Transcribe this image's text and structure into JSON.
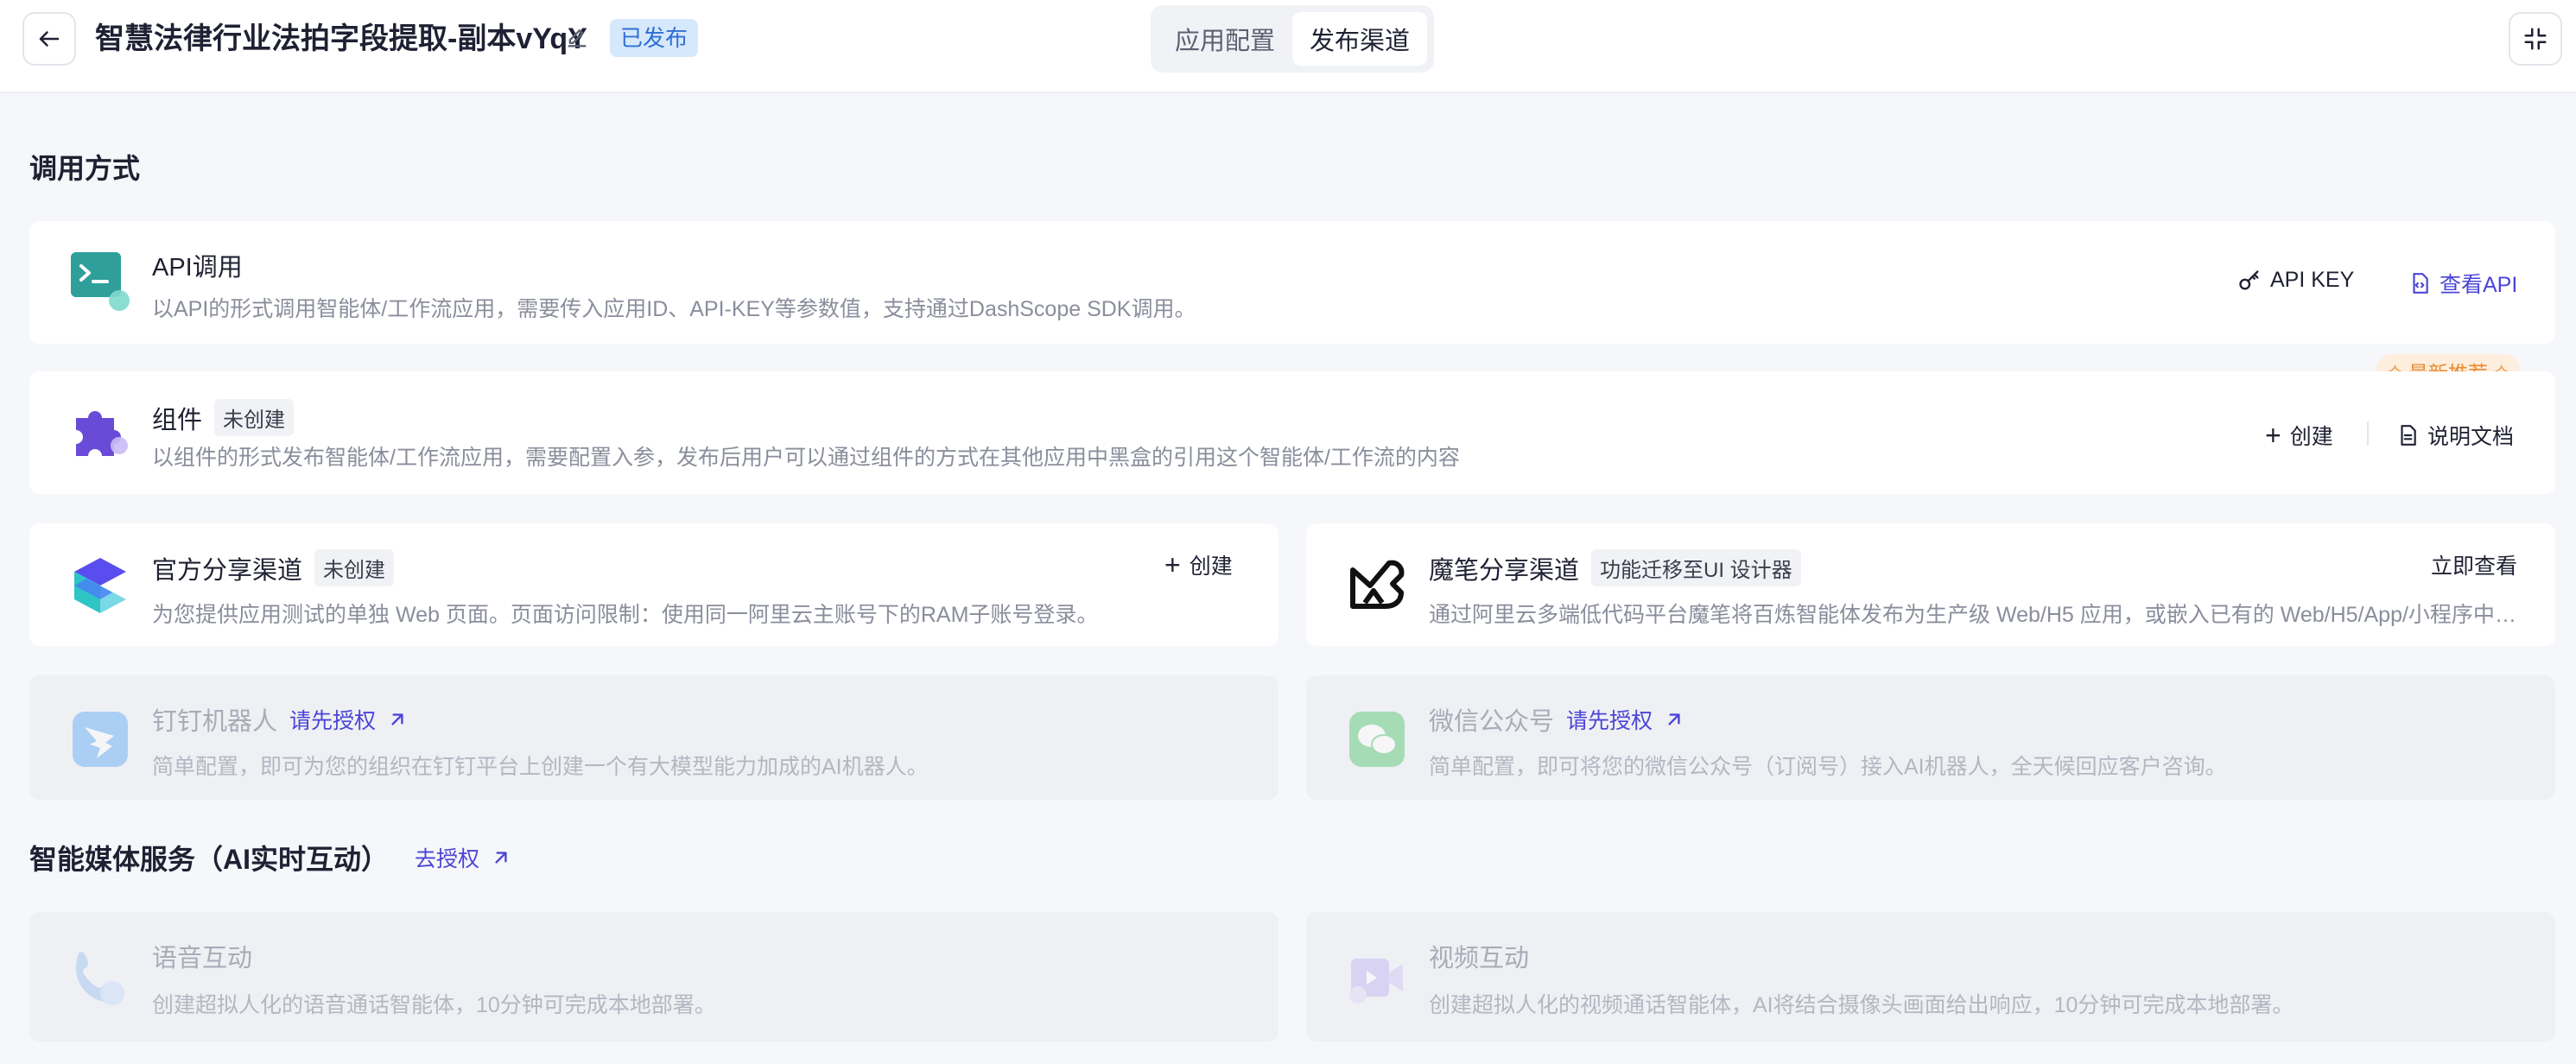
{
  "header": {
    "back_icon": "arrow-left-icon",
    "title": "智慧法律行业法拍字段提取-副本vYqY",
    "edit_icon": "pencil-icon",
    "status": "已发布",
    "tabs": [
      {
        "label": "应用配置",
        "active": false
      },
      {
        "label": "发布渠道",
        "active": true
      }
    ],
    "collapse_icon": "minimize-icon"
  },
  "invoke_section": {
    "title": "调用方式",
    "api": {
      "icon": "terminal-icon",
      "title": "API调用",
      "desc": "以API的形式调用智能体/工作流应用，需要传入应用ID、API-KEY等参数值，支持通过DashScope SDK调用。",
      "api_key_label": "API KEY",
      "view_api_label": "查看API"
    },
    "component": {
      "icon": "puzzle-icon",
      "title": "组件",
      "tag": "未创建",
      "desc": "以组件的形式发布智能体/工作流应用，需要配置入参，发布后用户可以通过组件的方式在其他应用中黑盒的引用这个智能体/工作流的内容",
      "badge": "最新推荐",
      "create_label": "创建",
      "docs_label": "说明文档"
    },
    "official_share": {
      "icon": "bailian-logo-icon",
      "title": "官方分享渠道",
      "tag": "未创建",
      "desc": "为您提供应用测试的单独 Web 页面。页面访问限制：使用同一阿里云主账号下的RAM子账号登录。",
      "create_label": "创建"
    },
    "mobi_share": {
      "icon": "mobi-logo-icon",
      "title": "魔笔分享渠道",
      "tag": "功能迁移至UI 设计器",
      "desc": "通过阿里云多端低代码平台魔笔将百炼智能体发布为生产级 Web/H5 应用，或嵌入已有的 Web/H5/App/小程序中。您...",
      "view_label": "立即查看"
    },
    "dingtalk": {
      "icon": "dingtalk-icon",
      "title": "钉钉机器人",
      "auth_label": "请先授权",
      "desc": "简单配置，即可为您的组织在钉钉平台上创建一个有大模型能力加成的AI机器人。"
    },
    "wechat": {
      "icon": "wechat-icon",
      "title": "微信公众号",
      "auth_label": "请先授权",
      "desc": "简单配置，即可将您的微信公众号（订阅号）接入AI机器人，全天候回应客户咨询。"
    }
  },
  "media_section": {
    "title": "智能媒体服务（AI实时互动）",
    "auth_label": "去授权",
    "voice": {
      "icon": "phone-icon",
      "title": "语音互动",
      "desc": "创建超拟人化的语音通话智能体，10分钟可完成本地部署。"
    },
    "video": {
      "icon": "video-icon",
      "title": "视频互动",
      "desc": "创建超拟人化的视频通话智能体，AI将结合摄像头画面给出响应，10分钟可完成本地部署。"
    }
  }
}
